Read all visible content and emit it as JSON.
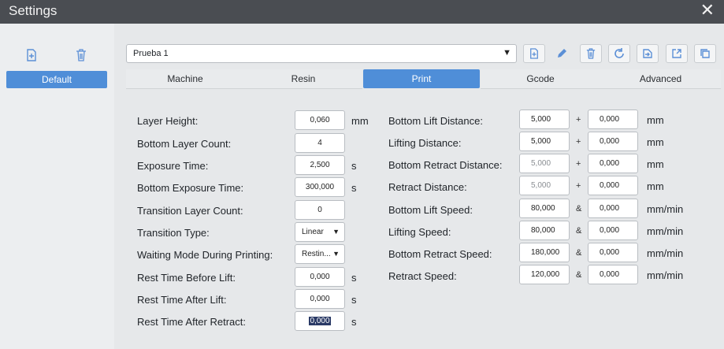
{
  "window": {
    "title": "Settings"
  },
  "profile": {
    "selected": "Prueba 1"
  },
  "left_panel": {
    "default_label": "Default"
  },
  "tabs": [
    {
      "label": "Machine"
    },
    {
      "label": "Resin"
    },
    {
      "label": "Print"
    },
    {
      "label": "Gcode"
    },
    {
      "label": "Advanced"
    }
  ],
  "left_settings": [
    {
      "label": "Layer Height:",
      "value": "0,060",
      "unit": "mm"
    },
    {
      "label": "Bottom Layer Count:",
      "value": "4",
      "unit": ""
    },
    {
      "label": "Exposure Time:",
      "value": "2,500",
      "unit": "s"
    },
    {
      "label": "Bottom Exposure Time:",
      "value": "300,000",
      "unit": "s"
    },
    {
      "label": "Transition Layer Count:",
      "value": "0",
      "unit": ""
    },
    {
      "label": "Transition Type:",
      "value": "Linear",
      "unit": ""
    },
    {
      "label": "Waiting Mode During Printing:",
      "value": "Restin...",
      "unit": ""
    },
    {
      "label": "Rest Time Before Lift:",
      "value": "0,000",
      "unit": "s"
    },
    {
      "label": "Rest Time After Lift:",
      "value": "0,000",
      "unit": "s"
    },
    {
      "label": "Rest Time After Retract:",
      "value": "0,000",
      "unit": "s"
    }
  ],
  "right_settings": [
    {
      "label": "Bottom Lift Distance:",
      "value1": "5,000",
      "op": "+",
      "value2": "0,000",
      "unit": "mm"
    },
    {
      "label": "Lifting Distance:",
      "value1": "5,000",
      "op": "+",
      "value2": "0,000",
      "unit": "mm"
    },
    {
      "label": "Bottom Retract Distance:",
      "value1": "5,000",
      "op": "+",
      "value2": "0,000",
      "unit": "mm"
    },
    {
      "label": "Retract Distance:",
      "value1": "5,000",
      "op": "+",
      "value2": "0,000",
      "unit": "mm"
    },
    {
      "label": "Bottom Lift Speed:",
      "value1": "80,000",
      "op": "&",
      "value2": "0,000",
      "unit": "mm/min"
    },
    {
      "label": "Lifting Speed:",
      "value1": "80,000",
      "op": "&",
      "value2": "0,000",
      "unit": "mm/min"
    },
    {
      "label": "Bottom Retract Speed:",
      "value1": "180,000",
      "op": "&",
      "value2": "0,000",
      "unit": "mm/min"
    },
    {
      "label": "Retract Speed:",
      "value1": "120,000",
      "op": "&",
      "value2": "0,000",
      "unit": "mm/min"
    }
  ],
  "icons": {
    "close": "close-icon",
    "add_profile": "add-file-icon",
    "delete_profile": "trash-icon",
    "toolbar": [
      "add-file-icon",
      "pencil-icon",
      "trash-icon",
      "refresh-icon",
      "import-icon",
      "export-icon",
      "copy-icon"
    ]
  },
  "colors": {
    "accent": "#4f8ed8",
    "titlebar": "#4a4d52"
  }
}
